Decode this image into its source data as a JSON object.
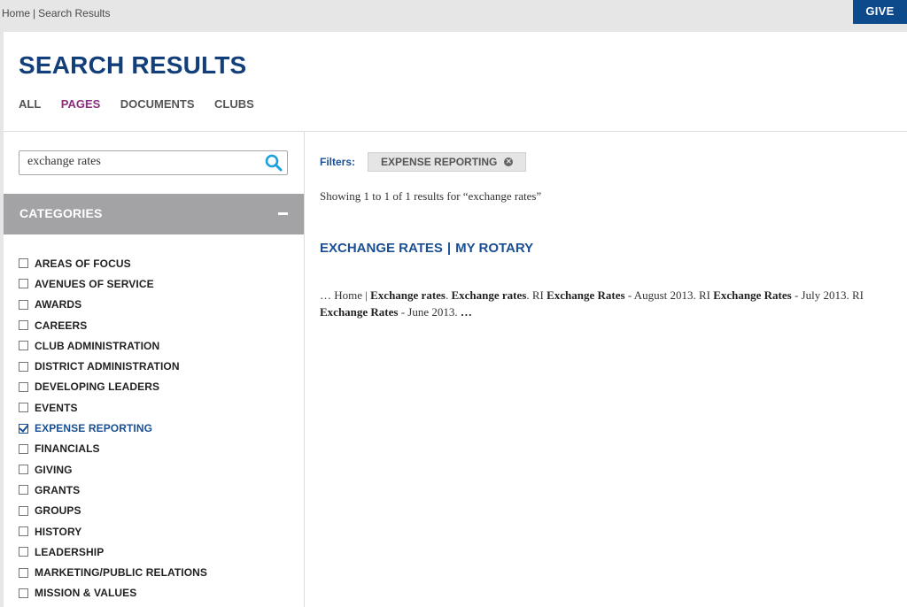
{
  "breadcrumb": {
    "home": "Home",
    "separator": "|",
    "current": "Search Results"
  },
  "give_label": "GIVE",
  "page_title": "SEARCH RESULTS",
  "tabs": [
    {
      "label": "ALL",
      "active": false
    },
    {
      "label": "PAGES",
      "active": true
    },
    {
      "label": "DOCUMENTS",
      "active": false
    },
    {
      "label": "CLUBS",
      "active": false
    }
  ],
  "search": {
    "value": "exchange rates"
  },
  "categories": {
    "heading": "CATEGORIES",
    "items": [
      {
        "label": "AREAS OF FOCUS",
        "checked": false
      },
      {
        "label": "AVENUES OF SERVICE",
        "checked": false
      },
      {
        "label": "AWARDS",
        "checked": false
      },
      {
        "label": "CAREERS",
        "checked": false
      },
      {
        "label": "CLUB ADMINISTRATION",
        "checked": false
      },
      {
        "label": "DISTRICT ADMINISTRATION",
        "checked": false
      },
      {
        "label": "DEVELOPING LEADERS",
        "checked": false
      },
      {
        "label": "EVENTS",
        "checked": false
      },
      {
        "label": "EXPENSE REPORTING",
        "checked": true
      },
      {
        "label": "FINANCIALS",
        "checked": false
      },
      {
        "label": "GIVING",
        "checked": false
      },
      {
        "label": "GRANTS",
        "checked": false
      },
      {
        "label": "GROUPS",
        "checked": false
      },
      {
        "label": "HISTORY",
        "checked": false
      },
      {
        "label": "LEADERSHIP",
        "checked": false
      },
      {
        "label": "MARKETING/PUBLIC RELATIONS",
        "checked": false
      },
      {
        "label": "MISSION & VALUES",
        "checked": false
      }
    ]
  },
  "filters": {
    "label": "Filters:",
    "active": [
      "EXPENSE REPORTING"
    ]
  },
  "results": {
    "summary": "Showing 1 to 1 of 1 results for “exchange rates”",
    "items": [
      {
        "title": "EXCHANGE RATES",
        "title_separator": "|",
        "site": "MY ROTARY",
        "snippet": [
          {
            "text": "… Home | ",
            "bold": false
          },
          {
            "text": "Exchange rates",
            "bold": true
          },
          {
            "text": ". ",
            "bold": false
          },
          {
            "text": "Exchange rates",
            "bold": true
          },
          {
            "text": ". RI ",
            "bold": false
          },
          {
            "text": "Exchange Rates",
            "bold": true
          },
          {
            "text": " - August 2013. RI ",
            "bold": false
          },
          {
            "text": "Exchange Rates",
            "bold": true
          },
          {
            "text": " - July 2013. RI ",
            "bold": false
          },
          {
            "text": "Exchange Rates",
            "bold": true
          },
          {
            "text": " - June 2013. ",
            "bold": false
          },
          {
            "text": "…",
            "bold": true
          }
        ]
      }
    ]
  },
  "colors": {
    "brand_blue": "#123f7a",
    "link_blue": "#1a4f93",
    "active_tab": "#8b2f7c",
    "category_bar": "#a3a3a5",
    "give_button": "#0c4a8c"
  }
}
